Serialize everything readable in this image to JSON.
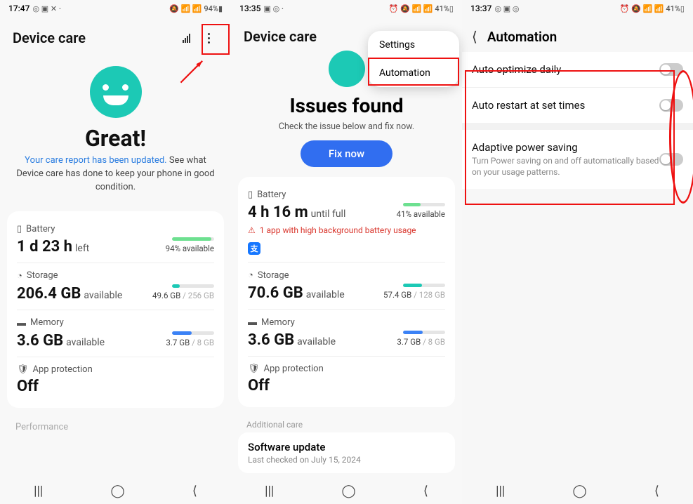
{
  "phone1": {
    "status": {
      "time": "17:47",
      "left_icons": "◎ ▣ ✕ ·",
      "right_icons": "🔕 📶 📶 94%▮",
      "battery": "94%"
    },
    "title": "Device care",
    "great": "Great!",
    "subtitle_link": "Your care report has been updated.",
    "subtitle_rest": " See what Device care has done to keep your phone in good condition.",
    "battery": {
      "label": "Battery",
      "value": "1 d 23 h",
      "unit": "left",
      "pct": "94% available",
      "fill": 94,
      "color": "#6de090"
    },
    "storage": {
      "label": "Storage",
      "value": "206.4 GB",
      "unit": "available",
      "used": "49.6 GB",
      "total": " / 256 GB",
      "fill": 19,
      "color": "#1cc9b5"
    },
    "memory": {
      "label": "Memory",
      "value": "3.6 GB",
      "unit": "available",
      "used": "3.7 GB",
      "total": " / 8 GB",
      "fill": 46,
      "color": "#3b82f6"
    },
    "protection": {
      "label": "App protection",
      "value": "Off"
    },
    "performance": "Performance"
  },
  "phone2": {
    "status": {
      "time": "13:35",
      "left_icons": "▣ ◎ ·",
      "right_icons": "⏰ 🔕 📶 📶 41%▯",
      "battery": "41%"
    },
    "title": "Device care",
    "menu": {
      "settings": "Settings",
      "automation": "Automation"
    },
    "issues_title": "Issues found",
    "issues_sub": "Check the issue below and fix now.",
    "fix_button": "Fix now",
    "battery": {
      "label": "Battery",
      "value": "4 h 16 m",
      "unit": "until full",
      "pct": "41% available",
      "fill": 41,
      "color": "#6de090"
    },
    "warning": "1 app with high background battery usage",
    "app_icon": "支",
    "storage": {
      "label": "Storage",
      "value": "70.6 GB",
      "unit": "available",
      "used": "57.4 GB",
      "total": " / 128 GB",
      "fill": 45,
      "color": "#1cc9b5"
    },
    "memory": {
      "label": "Memory",
      "value": "3.6 GB",
      "unit": "available",
      "used": "3.7 GB",
      "total": " / 8 GB",
      "fill": 46,
      "color": "#3b82f6"
    },
    "protection": {
      "label": "App protection",
      "value": "Off"
    },
    "additional": "Additional care",
    "software": {
      "title": "Software update",
      "date": "Last checked on July 15, 2024"
    }
  },
  "phone3": {
    "status": {
      "time": "13:37",
      "left_icons": "◎ ▣ ◎",
      "right_icons": "⏰ 🔕 📶 📶 41%▯",
      "battery": "41%"
    },
    "title": "Automation",
    "rows": {
      "optimize": "Auto optimize daily",
      "restart": "Auto restart at set times",
      "adaptive": "Adaptive power saving",
      "adaptive_sub": "Turn Power saving on and off automatically based on your usage patterns."
    }
  }
}
